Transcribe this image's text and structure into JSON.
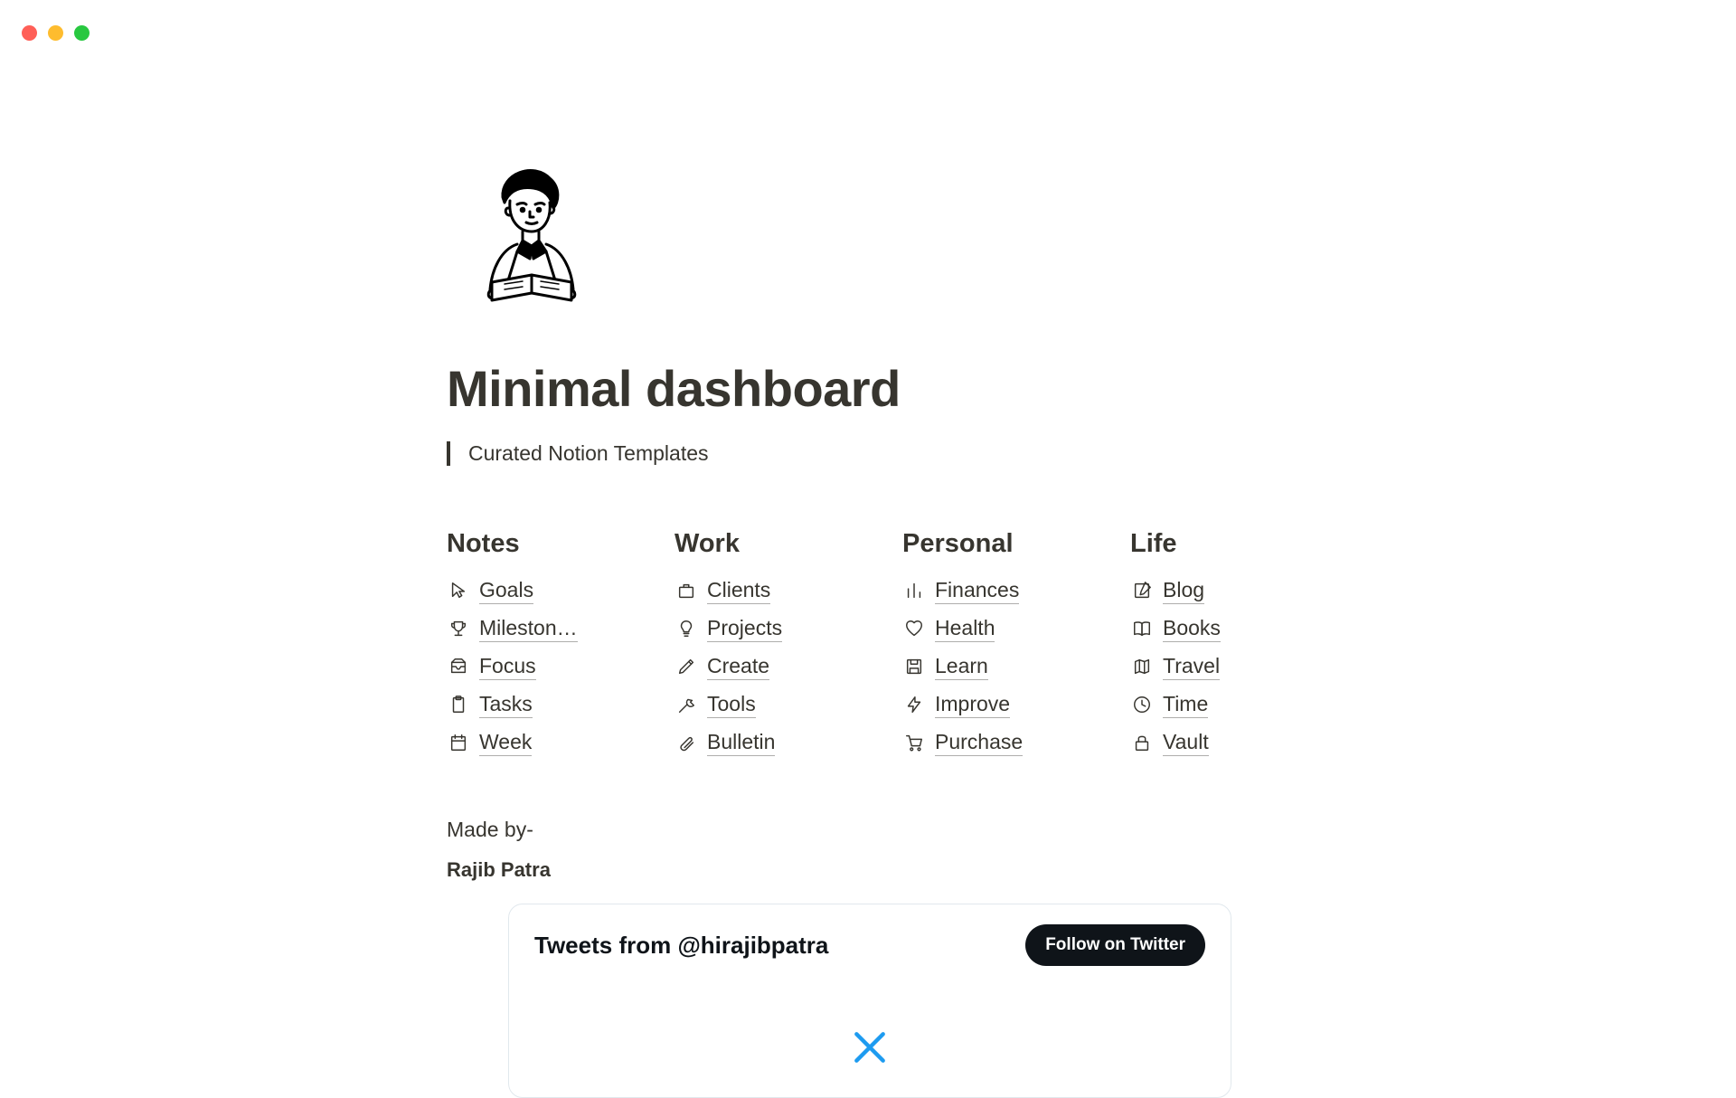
{
  "window": {
    "traffic_lights": [
      "red",
      "yellow",
      "green"
    ]
  },
  "page": {
    "title": "Minimal dashboard",
    "subtitle": "Curated Notion Templates",
    "made_by_label": "Made by-",
    "author": "Rajib Patra"
  },
  "columns": [
    {
      "heading": "Notes",
      "items": [
        {
          "icon": "cursor-icon",
          "label": "Goals"
        },
        {
          "icon": "trophy-icon",
          "label": "Mileston…"
        },
        {
          "icon": "inbox-icon",
          "label": "Focus"
        },
        {
          "icon": "clipboard-icon",
          "label": "Tasks"
        },
        {
          "icon": "calendar-icon",
          "label": "Week"
        }
      ]
    },
    {
      "heading": "Work",
      "items": [
        {
          "icon": "briefcase-icon",
          "label": "Clients"
        },
        {
          "icon": "lightbulb-icon",
          "label": "Projects"
        },
        {
          "icon": "pencil-icon",
          "label": "Create"
        },
        {
          "icon": "wrench-icon",
          "label": "Tools"
        },
        {
          "icon": "paperclip-icon",
          "label": "Bulletin"
        }
      ]
    },
    {
      "heading": "Personal",
      "items": [
        {
          "icon": "bar-chart-icon",
          "label": "Finances"
        },
        {
          "icon": "heart-icon",
          "label": "Health"
        },
        {
          "icon": "save-icon",
          "label": "Learn"
        },
        {
          "icon": "lightning-icon",
          "label": "Improve"
        },
        {
          "icon": "cart-icon",
          "label": "Purchase"
        }
      ]
    },
    {
      "heading": "Life",
      "items": [
        {
          "icon": "edit-square-icon",
          "label": "Blog"
        },
        {
          "icon": "book-open-icon",
          "label": "Books"
        },
        {
          "icon": "map-icon",
          "label": "Travel"
        },
        {
          "icon": "clock-icon",
          "label": "Time"
        },
        {
          "icon": "lock-icon",
          "label": "Vault"
        }
      ]
    }
  ],
  "twitter_embed": {
    "title": "Tweets from @hirajibpatra",
    "follow_button": "Follow on Twitter"
  }
}
